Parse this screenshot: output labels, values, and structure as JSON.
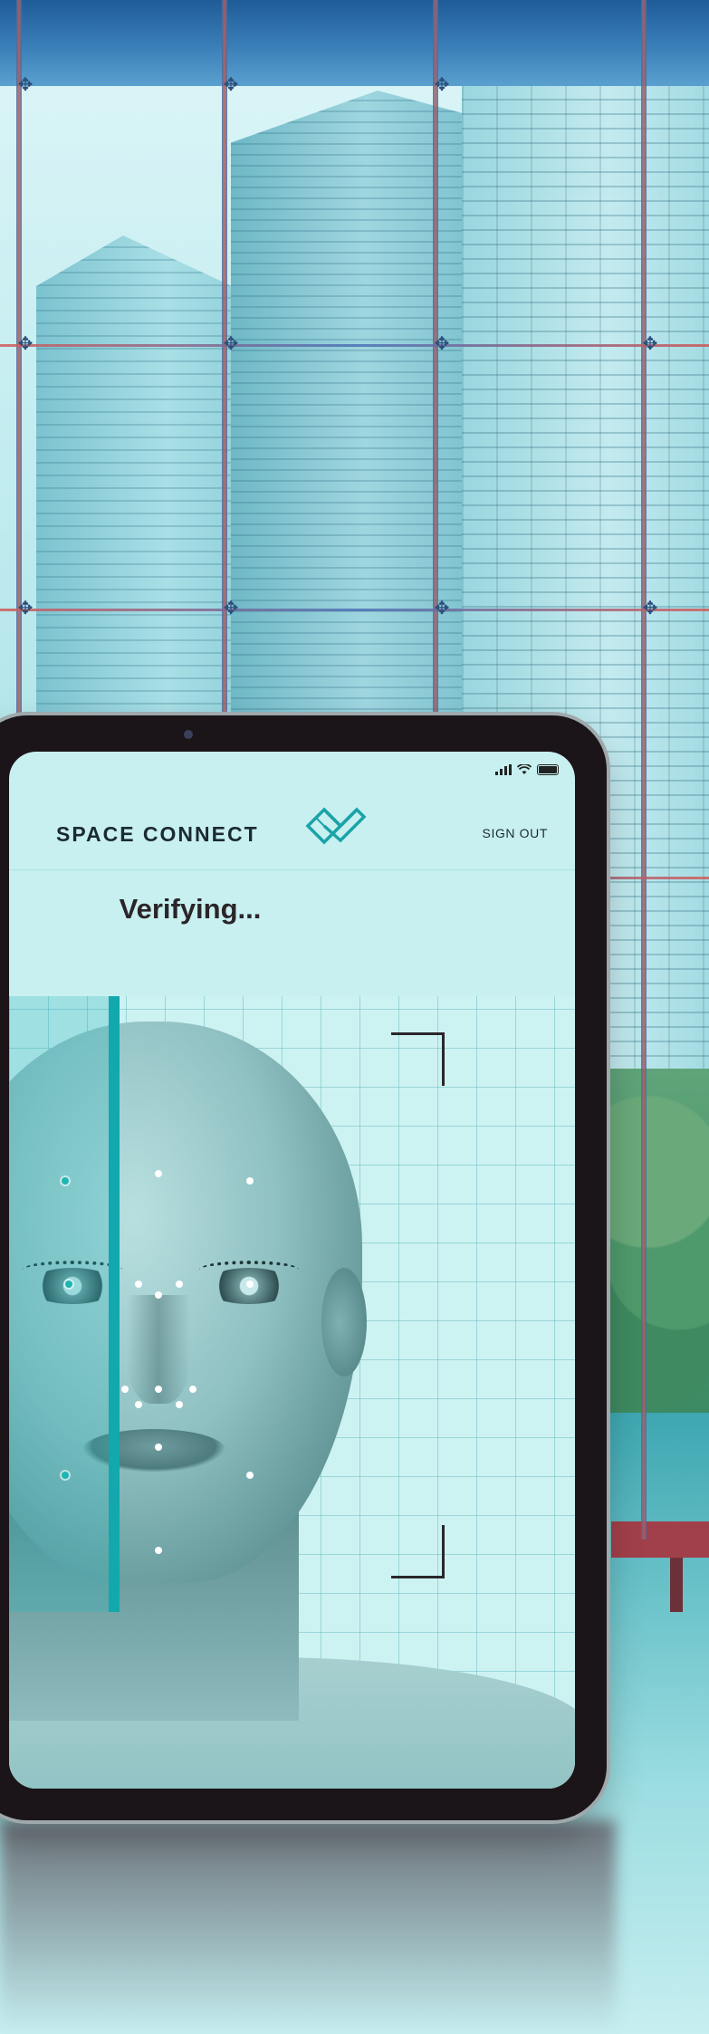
{
  "app": {
    "brand_name": "SPACE CONNECT",
    "sign_out_label": "SIGN OUT",
    "status_title": "Verifying..."
  },
  "icons": {
    "logo": "space-connect-logo",
    "signal": "cellular-signal-icon",
    "wifi": "wifi-icon",
    "battery": "battery-icon"
  },
  "colors": {
    "accent_teal": "#12a8ad",
    "screen_bg": "#c8f0f0",
    "grid_line": "#5ab4b9",
    "text_dark": "#1b2a33",
    "bezel": "#1b1418"
  }
}
